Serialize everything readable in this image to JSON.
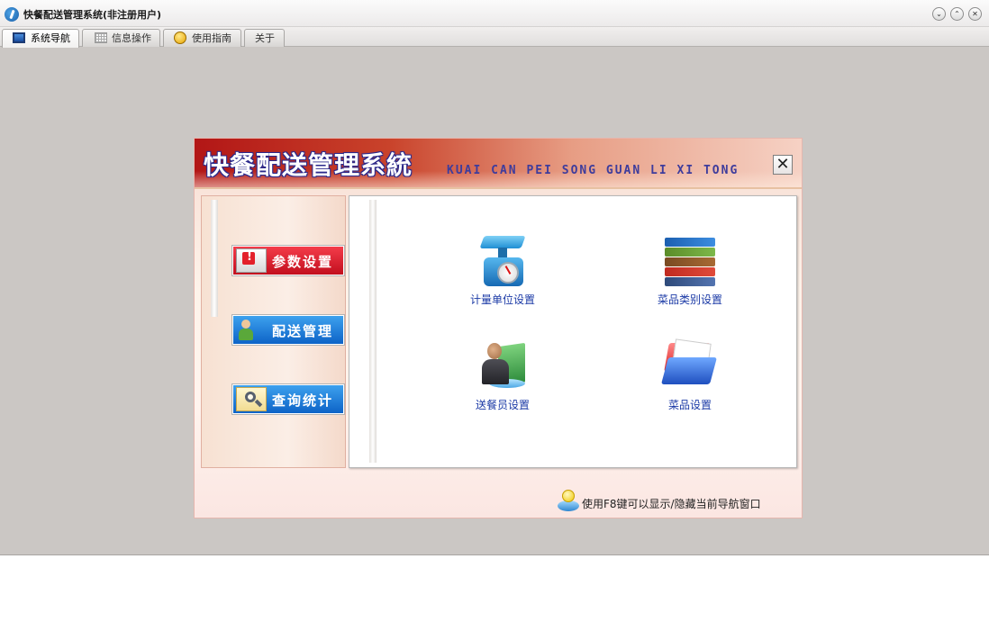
{
  "window": {
    "title": "快餐配送管理系统(非注册用户)",
    "controls": [
      "chevron-down-icon",
      "chevron-up-icon",
      "close-icon"
    ]
  },
  "tabs": [
    {
      "label": "系统导航",
      "icon": "monitor-icon",
      "active": true
    },
    {
      "label": "信息操作",
      "icon": "grid-icon",
      "active": false
    },
    {
      "label": "使用指南",
      "icon": "smiley-icon",
      "active": false
    },
    {
      "label": "关于",
      "active": false
    }
  ],
  "panel": {
    "title": "快餐配送管理系統",
    "subtitle": "KUAI CAN PEI SONG GUAN LI XI TONG",
    "close_label": "✕"
  },
  "menu": [
    {
      "label": "参数设置",
      "icon": "alert-monitor-icon",
      "color": "#d81c2a"
    },
    {
      "label": "配送管理",
      "icon": "delivery-person-icon",
      "color": "#1677d6"
    },
    {
      "label": "查询统计",
      "icon": "search-icon",
      "color": "#1677d6"
    }
  ],
  "functions": [
    {
      "label": "计量单位设置",
      "icon": "scale-icon"
    },
    {
      "label": "菜品类别设置",
      "icon": "books-icon"
    },
    {
      "label": "送餐员设置",
      "icon": "person-folder-icon"
    },
    {
      "label": "菜品设置",
      "icon": "folder-icon"
    }
  ],
  "hint": {
    "text": "使用F8键可以显示/隐藏当前导航窗口",
    "icon": "lightbulb-icon"
  }
}
